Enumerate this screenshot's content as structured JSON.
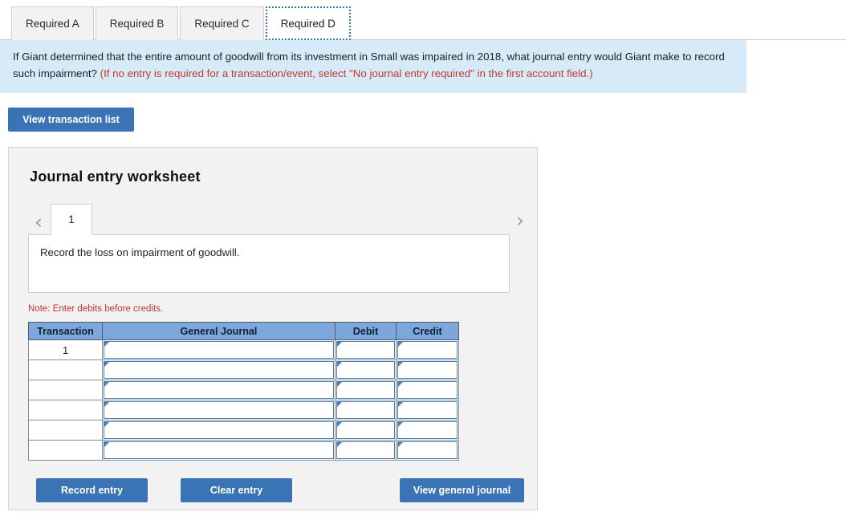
{
  "tabs": [
    {
      "label": "Required A",
      "active": false
    },
    {
      "label": "Required B",
      "active": false
    },
    {
      "label": "Required C",
      "active": false
    },
    {
      "label": "Required D",
      "active": true
    }
  ],
  "question": {
    "text": "If Giant determined that the entire amount of goodwill from its investment in Small was impaired in 2018, what journal entry would Giant make to record such impairment? ",
    "hint": "(If no entry is required for a transaction/event, select \"No journal entry required\" in the first account field.)"
  },
  "toolbar": {
    "view_transaction_list_label": "View transaction list"
  },
  "worksheet": {
    "title": "Journal entry worksheet",
    "prev_icon": "‹",
    "next_icon": "›",
    "entry_tabs": [
      {
        "label": "1",
        "active": true
      }
    ],
    "description": "Record the loss on impairment of goodwill.",
    "note": "Note: Enter debits before credits.",
    "table": {
      "headers": [
        "Transaction",
        "General Journal",
        "Debit",
        "Credit"
      ],
      "rows": [
        {
          "transaction": "1",
          "general_journal": "",
          "debit": "",
          "credit": ""
        },
        {
          "transaction": "",
          "general_journal": "",
          "debit": "",
          "credit": ""
        },
        {
          "transaction": "",
          "general_journal": "",
          "debit": "",
          "credit": ""
        },
        {
          "transaction": "",
          "general_journal": "",
          "debit": "",
          "credit": ""
        },
        {
          "transaction": "",
          "general_journal": "",
          "debit": "",
          "credit": ""
        },
        {
          "transaction": "",
          "general_journal": "",
          "debit": "",
          "credit": ""
        }
      ]
    },
    "footer": {
      "record_entry_label": "Record entry",
      "clear_entry_label": "Clear entry",
      "view_general_journal_label": "View general journal"
    }
  },
  "colors": {
    "accent_blue": "#3b74b4",
    "table_header_blue": "#7ba7dc",
    "info_box_blue": "#d7eaf8",
    "hint_red": "#c0392b",
    "panel_gray": "#f2f2f2"
  }
}
